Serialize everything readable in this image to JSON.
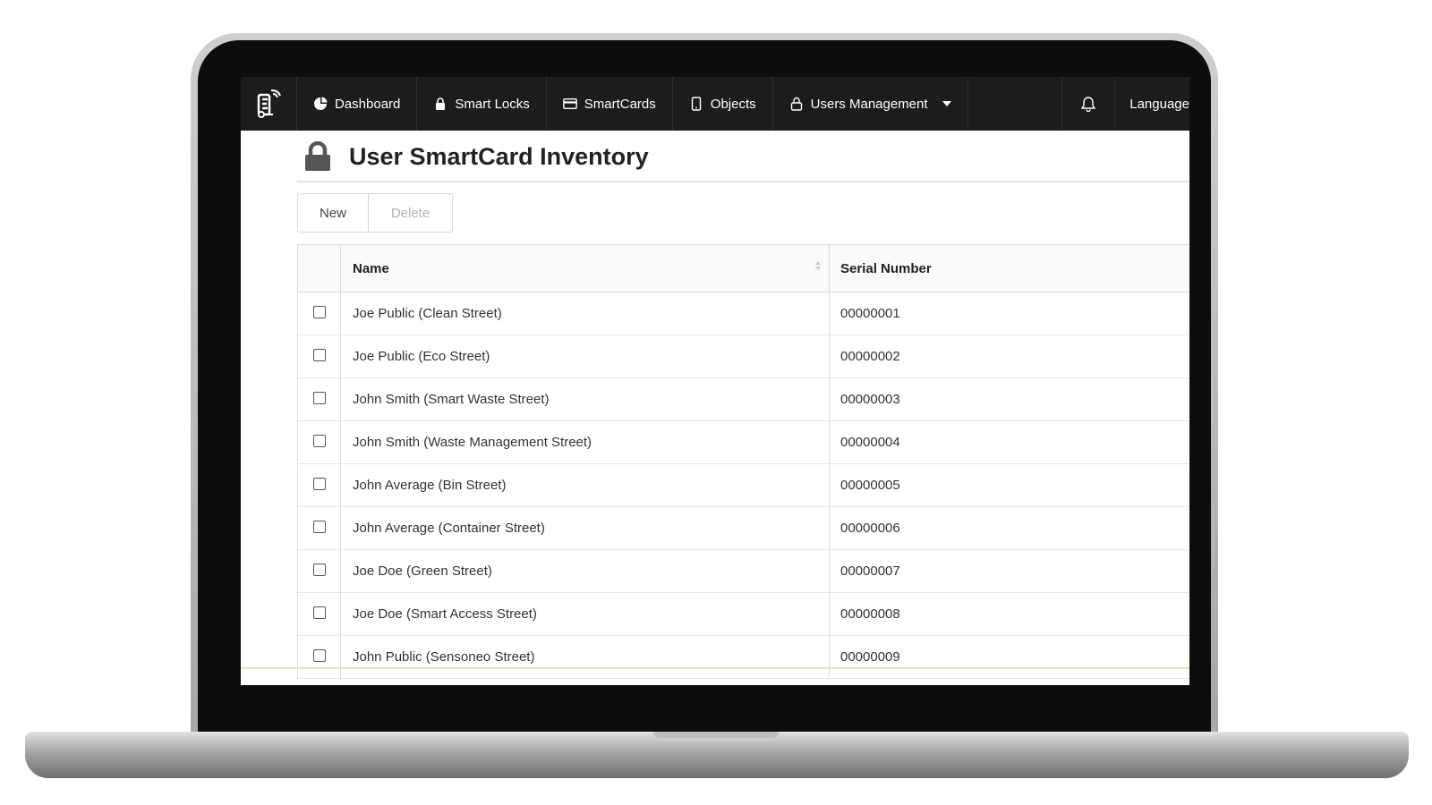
{
  "nav": {
    "items": [
      {
        "label": "Dashboard",
        "icon": "pie-chart-icon"
      },
      {
        "label": "Smart Locks",
        "icon": "lock-icon"
      },
      {
        "label": "SmartCards",
        "icon": "credit-card-icon"
      },
      {
        "label": "Objects",
        "icon": "mobile-icon"
      },
      {
        "label": "Users Management",
        "icon": "user-icon"
      }
    ],
    "language_label": "Language",
    "bell_icon": "bell-icon",
    "logo_icon": "logo-icon"
  },
  "page": {
    "title": "User SmartCard Inventory",
    "title_icon": "lock-icon"
  },
  "toolbar": {
    "new_label": "New",
    "delete_label": "Delete"
  },
  "table": {
    "columns": [
      "Name",
      "Serial Number"
    ],
    "rows": [
      {
        "name": "Joe Public (Clean Street)",
        "serial": "00000001"
      },
      {
        "name": "Joe Public (Eco Street)",
        "serial": "00000002"
      },
      {
        "name": "John Smith (Smart Waste Street)",
        "serial": "00000003"
      },
      {
        "name": "John Smith (Waste Management Street)",
        "serial": "00000004"
      },
      {
        "name": "John Average (Bin Street)",
        "serial": "00000005"
      },
      {
        "name": "John Average (Container Street)",
        "serial": "00000006"
      },
      {
        "name": "Joe Doe (Green Street)",
        "serial": "00000007"
      },
      {
        "name": "Joe Doe (Smart Access Street)",
        "serial": "00000008"
      },
      {
        "name": "John Public (Sensoneo Street)",
        "serial": "00000009"
      }
    ]
  },
  "colors": {
    "nav_bg": "#1b1c1d",
    "header_bg": "#f9fafb",
    "disabled_text": "#b3b3b3"
  }
}
